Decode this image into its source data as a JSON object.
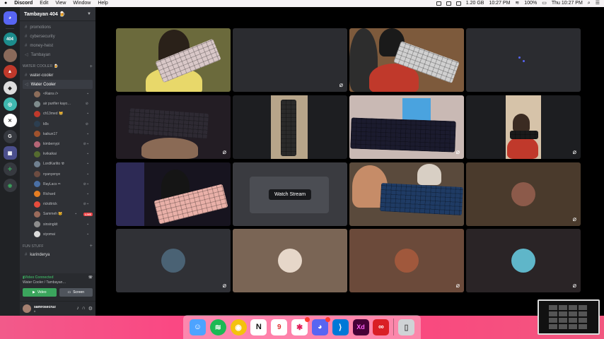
{
  "menubar": {
    "app": "Discord",
    "items": [
      "Edit",
      "View",
      "Window",
      "Help"
    ],
    "storage": "1.20 GB",
    "time": "10:27 PM",
    "battery": "100%",
    "datetime": "Thu 10:27 PM"
  },
  "server_rail": {
    "badge_label": "404",
    "g_label": "G"
  },
  "guild": {
    "name": "Tambayan 404 🍺"
  },
  "channels": {
    "top": [
      "promotions",
      "cybersecurity",
      "money-heist",
      "Tambayan"
    ],
    "category_water": "WATER COOLER 🍺",
    "text_channel": "water-cooler",
    "voice_channel": "Water Cooler",
    "voice_users": [
      "<Rains />",
      "air purifier kayo…",
      "ch13med 😸",
      "k8s",
      "kaikun17",
      "kimberrypi",
      "kvikaikai",
      "LordKarlito ☢",
      "nyanyenye",
      "RayLacs ✏",
      "Richard",
      "rickdtrick",
      "Sammeh 🐱",
      "sinsingkit",
      "siyomai"
    ],
    "live_label": "LIVE",
    "category_fun": "FUN STUFF",
    "fun_channel": "karinderya"
  },
  "voice_panel": {
    "status": "Video Connected",
    "sub": "Water Cooler / Tambayan…",
    "video_btn": "Video",
    "screen_btn": "Screen"
  },
  "user": {
    "name": "samrosecruz",
    "tag": "#"
  },
  "stage": {
    "watch_stream": "Watch Stream"
  },
  "dock": {
    "calendar_day": "9",
    "notion": "N",
    "xd": "Xd"
  },
  "colors": {
    "discord_green": "#3ba55d",
    "live_red": "#ed4245",
    "blurple": "#5865f2"
  }
}
